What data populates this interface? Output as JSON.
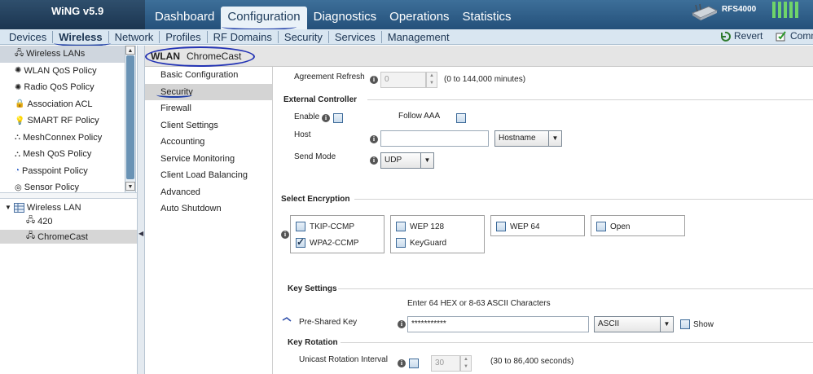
{
  "app": {
    "title": "WiNG v5.9",
    "device_name": "RFS4000"
  },
  "main_nav": [
    "Dashboard",
    "Configuration",
    "Diagnostics",
    "Operations",
    "Statistics"
  ],
  "sub_nav": [
    "Devices",
    "Wireless",
    "Network",
    "Profiles",
    "RF Domains",
    "Security",
    "Services",
    "Management"
  ],
  "actions": {
    "revert": "Revert",
    "commit": "Comm"
  },
  "wireless_menu": [
    "Wireless LANs",
    "WLAN QoS Policy",
    "Radio QoS Policy",
    "Association ACL",
    "SMART RF Policy",
    "MeshConnex Policy",
    "Mesh QoS Policy",
    "Passpoint Policy",
    "Sensor Policy"
  ],
  "tree": {
    "root": "Wireless LAN",
    "children": [
      "420",
      "ChromeCast"
    ]
  },
  "content_header": {
    "label": "WLAN",
    "name": "ChromeCast"
  },
  "wlan_menu": [
    "Basic Configuration",
    "Security",
    "Firewall",
    "Client Settings",
    "Accounting",
    "Service Monitoring",
    "Client Load Balancing",
    "Advanced",
    "Auto Shutdown"
  ],
  "form": {
    "agreement_refresh": {
      "label": "Agreement Refresh",
      "value": "0",
      "hint": "(0 to 144,000 minutes)"
    },
    "external_controller": {
      "title": "External Controller",
      "enable_label": "Enable",
      "follow_aaa_label": "Follow AAA",
      "host_label": "Host",
      "host_value": "",
      "host_type": "Hostname",
      "send_mode_label": "Send Mode",
      "send_mode": "UDP"
    },
    "encryption": {
      "title": "Select Encryption",
      "tkip": "TKIP-CCMP",
      "wpa2": "WPA2-CCMP",
      "wep128": "WEP 128",
      "keyguard": "KeyGuard",
      "wep64": "WEP 64",
      "open": "Open"
    },
    "key_settings": {
      "title": "Key Settings",
      "hint": "Enter 64 HEX or 8-63 ASCII Characters",
      "psk_label": "Pre-Shared Key",
      "psk_value": "***********",
      "format": "ASCII",
      "show_label": "Show"
    },
    "key_rotation": {
      "title": "Key Rotation",
      "unicast_label": "Unicast Rotation Interval",
      "unicast_value": "30",
      "unicast_hint": "(30 to 86,400 seconds)"
    }
  }
}
